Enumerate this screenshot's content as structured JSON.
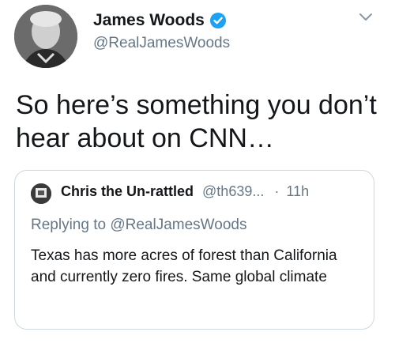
{
  "author": {
    "name": "James Woods",
    "handle": "@RealJamesWoods",
    "verified": true
  },
  "tweet": {
    "text": "So here’s something you don’t hear about on CNN…"
  },
  "quoted_tweet": {
    "name": "Chris the Un-rattled",
    "handle": "@th639...",
    "separator": "·",
    "time": "11h",
    "replying_prefix": "Replying to",
    "replying_to": "@RealJamesWoods",
    "text": "Texas has more acres of forest than California and currently zero fires. Same global climate"
  },
  "icons": {
    "verified": "verified-badge-icon",
    "menu": "chevron-down-icon"
  },
  "colors": {
    "verified_blue": "#1da1f2",
    "secondary_text": "#657786",
    "border": "#cfd8df"
  }
}
